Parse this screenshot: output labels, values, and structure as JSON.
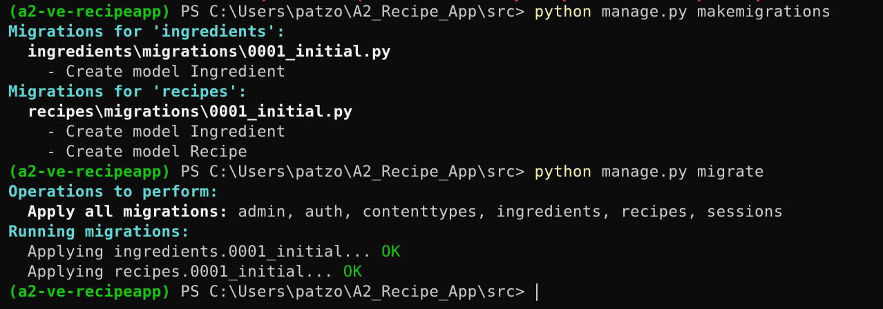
{
  "terminal": {
    "lines": [
      {
        "type": "prompt",
        "env": "(a2-ve-recipeapp)",
        "path": " PS C:\\Users\\patzo\\A2_Recipe_App\\src> ",
        "command": "python",
        "args": " manage.py makemigrations"
      },
      {
        "type": "plain",
        "text": "Migrations for 'ingredients':",
        "style": "cyan-bold"
      },
      {
        "type": "plain",
        "text": "  ingredients\\migrations\\0001_initial.py",
        "style": "white-bold"
      },
      {
        "type": "plain",
        "text": "    - Create model Ingredient",
        "style": "gray"
      },
      {
        "type": "plain",
        "text": "Migrations for 'recipes':",
        "style": "cyan-bold"
      },
      {
        "type": "plain",
        "text": "  recipes\\migrations\\0001_initial.py",
        "style": "white-bold"
      },
      {
        "type": "plain",
        "text": "    - Create model Ingredient",
        "style": "gray"
      },
      {
        "type": "plain",
        "text": "    - Create model Recipe",
        "style": "gray"
      },
      {
        "type": "prompt",
        "env": "(a2-ve-recipeapp)",
        "path": " PS C:\\Users\\patzo\\A2_Recipe_App\\src> ",
        "command": "python",
        "args": " manage.py migrate"
      },
      {
        "type": "plain",
        "text": "Operations to perform:",
        "style": "cyan-bold"
      },
      {
        "type": "labeled",
        "label": "  Apply all migrations:",
        "value": " admin, auth, contenttypes, ingredients, recipes, sessions"
      },
      {
        "type": "plain",
        "text": "Running migrations:",
        "style": "cyan-bold"
      },
      {
        "type": "status",
        "text": "  Applying ingredients.0001_initial...",
        "status": " OK"
      },
      {
        "type": "status",
        "text": "  Applying recipes.0001_initial...",
        "status": " OK"
      },
      {
        "type": "prompt",
        "env": "(a2-ve-recipeapp)",
        "path": " PS C:\\Users\\patzo\\A2_Recipe_App\\src> ",
        "command": "",
        "args": "",
        "cursor": true
      }
    ]
  },
  "colors": {
    "background": "#0c0c0c",
    "env": "#16c60c",
    "heading": "#61d6d6",
    "command": "#f9f1a5",
    "ok": "#16c60c",
    "text": "#cccccc"
  }
}
